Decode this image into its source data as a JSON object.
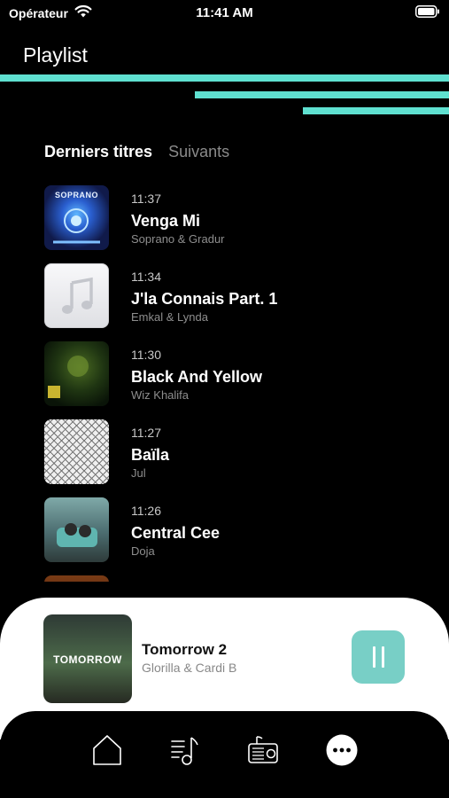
{
  "status_bar": {
    "carrier": "Opérateur",
    "time": "11:41 AM"
  },
  "header": {
    "title": "Playlist"
  },
  "tabs": [
    {
      "label": "Derniers titres",
      "active": true
    },
    {
      "label": "Suivants",
      "active": false
    }
  ],
  "tracks": [
    {
      "time": "11:37",
      "title": "Venga Mi",
      "artist": "Soprano & Gradur",
      "cover_label": "SOPRANO"
    },
    {
      "time": "11:34",
      "title": "J'la Connais Part. 1",
      "artist": "Emkal & Lynda"
    },
    {
      "time": "11:30",
      "title": "Black And Yellow",
      "artist": "Wiz Khalifa"
    },
    {
      "time": "11:27",
      "title": "Baïla",
      "artist": "Jul"
    },
    {
      "time": "11:26",
      "title": "Central Cee",
      "artist": "Doja"
    }
  ],
  "now_playing": {
    "title": "Tomorrow 2",
    "artist": "Glorilla & Cardi B",
    "cover_text": "TOMORROW",
    "state_icon": "pause-icon"
  },
  "nav": [
    {
      "icon": "home-icon"
    },
    {
      "icon": "playlist-icon"
    },
    {
      "icon": "radio-icon"
    },
    {
      "icon": "more-icon"
    }
  ],
  "colors": {
    "accent": "#5fe0d0",
    "pause_button": "#78cfc6",
    "background": "#000000"
  }
}
